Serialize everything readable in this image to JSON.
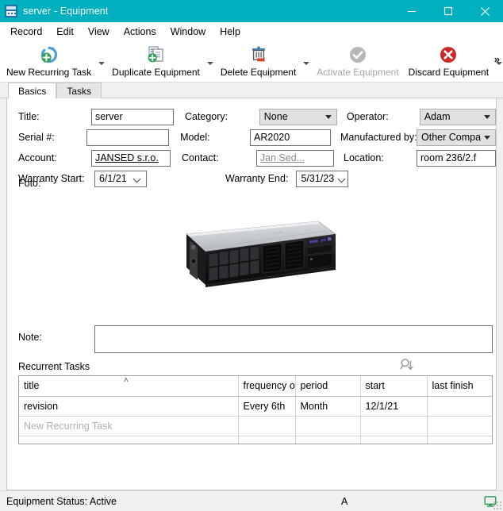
{
  "window": {
    "title": "server - Equipment",
    "icon": "equipment-app-icon",
    "accent_color": "#00b0bf",
    "minimize_label": "Minimize",
    "maximize_label": "Maximize",
    "close_label": "Close"
  },
  "menubar": {
    "items": [
      {
        "label": "Record"
      },
      {
        "label": "Edit"
      },
      {
        "label": "View"
      },
      {
        "label": "Actions"
      },
      {
        "label": "Window"
      },
      {
        "label": "Help"
      }
    ]
  },
  "toolbar": {
    "overflow_label": "»",
    "buttons": [
      {
        "label": "New Recurring Task",
        "icon": "new-recurring-task-icon",
        "disabled": false,
        "has_dropdown": true
      },
      {
        "label": "Duplicate Equipment",
        "icon": "duplicate-equipment-icon",
        "disabled": false,
        "has_dropdown": true
      },
      {
        "label": "Delete Equipment",
        "icon": "delete-equipment-icon",
        "disabled": false,
        "has_dropdown": true
      },
      {
        "label": "Activate Equipment",
        "icon": "activate-equipment-icon",
        "disabled": true,
        "has_dropdown": false
      },
      {
        "label": "Discard Equipment",
        "icon": "discard-equipment-icon",
        "disabled": false,
        "has_dropdown": true
      }
    ]
  },
  "tabs": [
    {
      "label": "Basics",
      "active": true
    },
    {
      "label": "Tasks",
      "active": false
    }
  ],
  "form": {
    "title": {
      "label": "Title:",
      "value": "server"
    },
    "category": {
      "label": "Category:",
      "value": "None"
    },
    "operator": {
      "label": "Operator:",
      "value": "Adam"
    },
    "serial": {
      "label": "Serial #:",
      "value": ""
    },
    "model": {
      "label": "Model:",
      "value": "AR2020"
    },
    "manufactured_by": {
      "label": "Manufactured by:",
      "value": "Other Company"
    },
    "account": {
      "label": "Account:",
      "value": "JANSED s.r.o."
    },
    "contact": {
      "label": "Contact:",
      "value": "Jan Sed..."
    },
    "location": {
      "label": "Location:",
      "value": "room 236/2.f"
    },
    "warranty_start": {
      "label": "Warranty Start:",
      "value": "6/1/21"
    },
    "warranty_end": {
      "label": "Warranty End:",
      "value": "5/31/23"
    },
    "foto": {
      "label": "Foto:",
      "image_alt": "rack-server-photo"
    },
    "note": {
      "label": "Note:",
      "value": ""
    }
  },
  "recurrent_tasks": {
    "section_label": "Recurrent Tasks",
    "search_icon": "search-down-icon",
    "sort_indicator": "˄",
    "columns": [
      "title",
      "frequency of",
      "period",
      "start",
      "last finish"
    ],
    "rows": [
      {
        "title": "revision",
        "frequency_of": "Every 6th",
        "period": "Month",
        "start": "12/1/21",
        "last_finish": ""
      }
    ],
    "new_row_placeholder": "New Recurring Task",
    "empty_row": {
      "title": "",
      "frequency_of": "",
      "period": "",
      "start": "",
      "last_finish": ""
    }
  },
  "statusbar": {
    "status_text": "Equipment Status: Active",
    "center_text": "A",
    "right_icon": "monitor-icon",
    "right_icon_color": "#2e9e5b"
  }
}
